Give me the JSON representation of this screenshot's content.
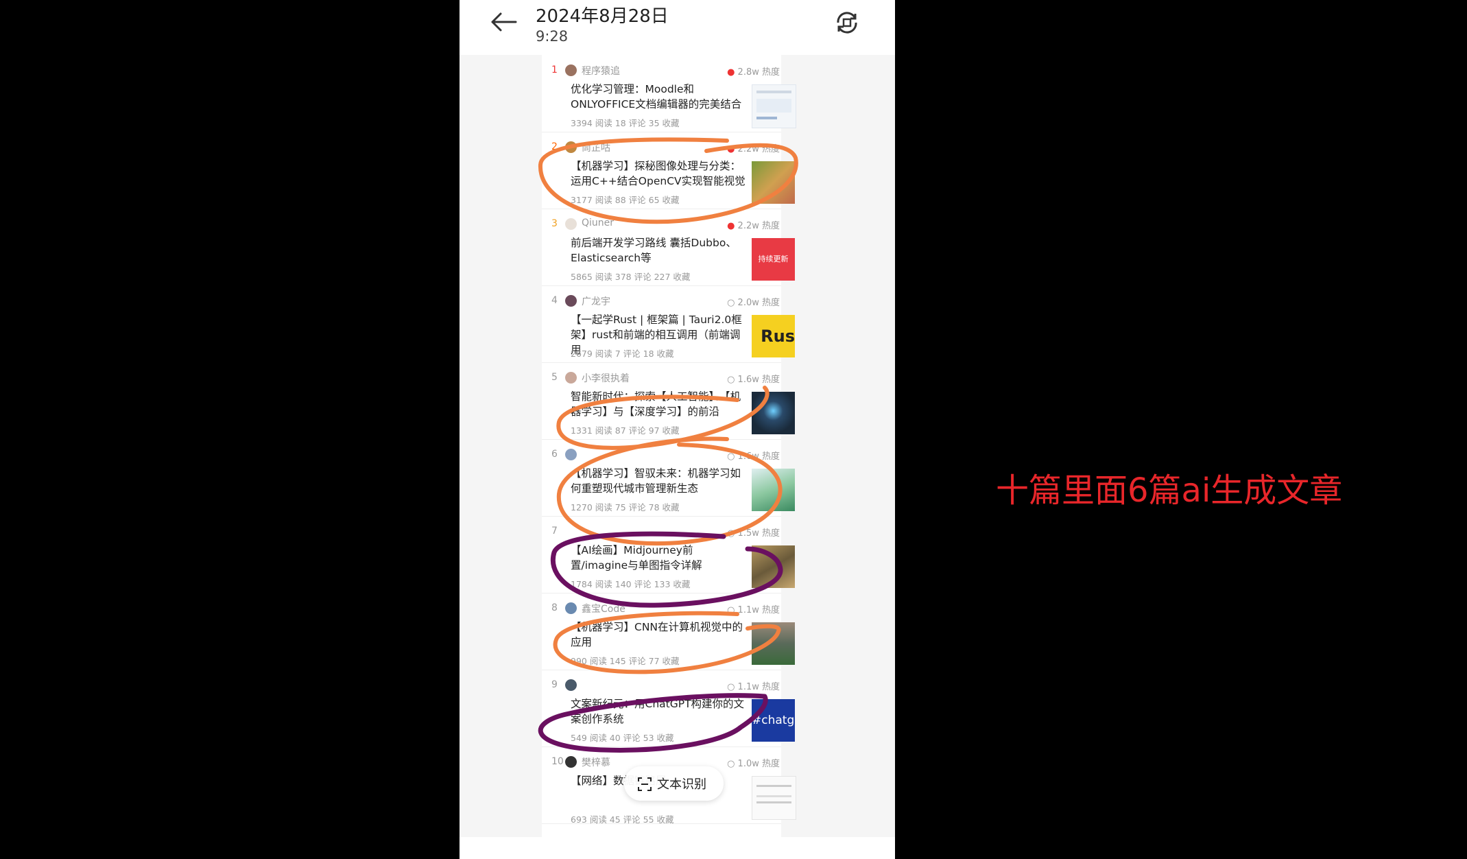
{
  "header": {
    "date": "2024年8月28日",
    "time": "9:28"
  },
  "articles": [
    {
      "rank": "1",
      "author": "程序猿追",
      "heat": "2.8w 热度",
      "title": "优化学习管理：Moodle和ONLYOFFICE文档编辑器的完美结合",
      "stats": "3394 阅读 18 评论 35 收藏"
    },
    {
      "rank": "2",
      "author": "茼芷咕",
      "heat": "2.2w 热度",
      "title": "【机器学习】探秘图像处理与分类：运用C++结合OpenCV实现智能视觉",
      "stats": "3177 阅读 88 评论 65 收藏"
    },
    {
      "rank": "3",
      "author": "Qiuner",
      "heat": "2.2w 热度",
      "title": "前后端开发学习路线 囊括Dubbo、Elasticsearch等",
      "stats": "5865 阅读 378 评论 227 收藏",
      "thumb_text": "持续更新"
    },
    {
      "rank": "4",
      "author": "广龙宇",
      "heat": "2.0w 热度",
      "title": "【一起学Rust | 框架篇 | Tauri2.0框架】rust和前端的相互调用（前端调用",
      "stats": "2679 阅读 7 评论 18 收藏",
      "thumb_text": "Rus"
    },
    {
      "rank": "5",
      "author": "小李很执着",
      "heat": "1.6w 热度",
      "title": "智能新时代：探索【人工智能】、【机器学习】与【深度学习】的前沿",
      "stats": "1331 阅读 87 评论 97 收藏"
    },
    {
      "rank": "6",
      "author": "",
      "heat": "1.6w 热度",
      "title": "【机器学习】智驭未来：机器学习如何重塑现代城市管理新生态",
      "stats": "1270 阅读 75 评论 78 收藏"
    },
    {
      "rank": "7",
      "author": "",
      "heat": "1.5w 热度",
      "title": "【AI绘画】Midjourney前置/imagine与单图指令详解",
      "stats": "1784 阅读 140 评论 133 收藏"
    },
    {
      "rank": "8",
      "author": "鑫宝Code",
      "heat": "1.1w 热度",
      "title": "【机器学习】CNN在计算机视觉中的应用",
      "stats": "990 阅读 145 评论 77 收藏"
    },
    {
      "rank": "9",
      "author": "",
      "heat": "1.1w 热度",
      "title": "文案新纪元：用ChatGPT构建你的文案创作系统",
      "stats": "549 阅读 40 评论 53 收藏",
      "thumb_text": "#chatgp"
    },
    {
      "rank": "10",
      "author": "樊梓慕",
      "heat": "1.0w 热度",
      "title": "【网络】数据链路层",
      "stats": "693 阅读 45 评论 55 收藏"
    }
  ],
  "ocr_button": {
    "label": "文本识别"
  },
  "annotation": {
    "text": "十篇里面6篇ai生成文章"
  },
  "colors": {
    "orange_mark": "#f08040",
    "purple_mark": "#6a1060",
    "annotation": "#e8262a",
    "rank_top": "#e33"
  },
  "icons": [
    "back-arrow-icon",
    "rotate-icon",
    "flame-icon",
    "hot-outline-icon",
    "scan-text-icon"
  ]
}
